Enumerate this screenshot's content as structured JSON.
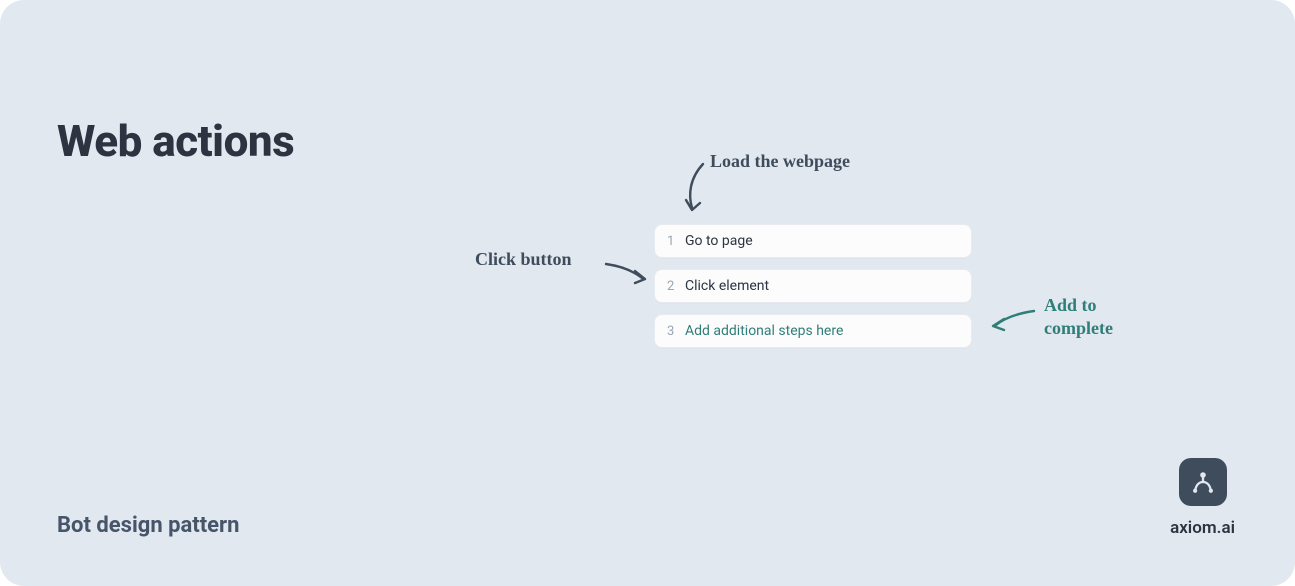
{
  "title": "Web actions",
  "subtitle": "Bot design pattern",
  "brand": "axiom.ai",
  "steps": [
    {
      "num": "1",
      "label": "Go to page",
      "placeholder": false
    },
    {
      "num": "2",
      "label": "Click element",
      "placeholder": false
    },
    {
      "num": "3",
      "label": "Add additional steps here",
      "placeholder": true
    }
  ],
  "annotations": {
    "load": "Load the webpage",
    "click": "Click button",
    "add": "Add to\ncomplete"
  }
}
